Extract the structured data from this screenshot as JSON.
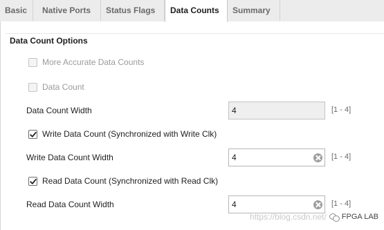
{
  "tabs": [
    {
      "label": "Basic",
      "active": false
    },
    {
      "label": "Native Ports",
      "active": false
    },
    {
      "label": "Status Flags",
      "active": false
    },
    {
      "label": "Data Counts",
      "active": true
    },
    {
      "label": "Summary",
      "active": false
    }
  ],
  "section": {
    "title": "Data Count Options"
  },
  "options": {
    "more_accurate": {
      "label": "More Accurate Data Counts",
      "checked": false,
      "enabled": false
    },
    "data_count": {
      "label": "Data Count",
      "checked": false,
      "enabled": false
    },
    "write_data_count": {
      "label": "Write Data Count (Synchronized with Write Clk)",
      "checked": true,
      "enabled": true
    },
    "read_data_count": {
      "label": "Read Data Count (Synchronized with Read Clk)",
      "checked": true,
      "enabled": true
    }
  },
  "fields": {
    "data_count_width": {
      "label": "Data Count Width",
      "value": "4",
      "range": "[1 - 4]",
      "readonly": true
    },
    "write_data_count_width": {
      "label": "Write Data Count Width",
      "value": "4",
      "range": "[1 - 4]",
      "readonly": false
    },
    "read_data_count_width": {
      "label": "Read Data Count Width",
      "value": "4",
      "range": "[1 - 4]",
      "readonly": false
    }
  },
  "icons": {
    "clear": "clear-circle-x-icon",
    "check": "checkmark-icon",
    "wechat": "wechat-icon"
  },
  "watermark": {
    "url": "https://blog.csdn.net/",
    "brand": "FPGA LAB"
  },
  "colors": {
    "tab_bar": "#ececec",
    "panel": "#ffffff",
    "readonly_field": "#efefef",
    "disabled_text": "#9a9a9a"
  }
}
